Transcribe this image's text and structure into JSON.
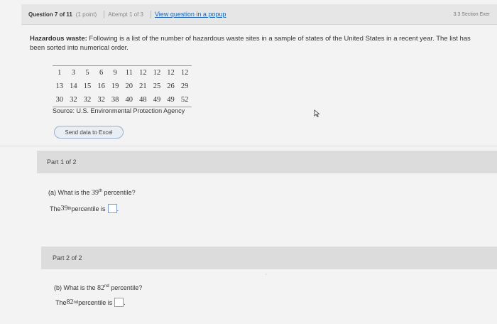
{
  "header": {
    "question_label": "Question 7 of 11",
    "points": "(1 point)",
    "attempt": "Attempt 1 of 3",
    "popup_link": "View question in a popup",
    "section": "3.3 Section Exer"
  },
  "problem": {
    "title": "Hazardous waste:",
    "text": " Following is a list of the number of hazardous waste sites in a sample of states of the United States in a recent year. The list has been sorted into numerical order."
  },
  "data_table": {
    "rows": [
      [
        "1",
        "3",
        "5",
        "6",
        "9",
        "11",
        "12",
        "12",
        "12",
        "12"
      ],
      [
        "13",
        "14",
        "15",
        "16",
        "19",
        "20",
        "21",
        "25",
        "26",
        "29"
      ],
      [
        "30",
        "32",
        "32",
        "32",
        "38",
        "40",
        "48",
        "49",
        "49",
        "52"
      ]
    ],
    "source": "Source: U.S. Environmental Protection Agency"
  },
  "actions": {
    "excel_button": "Send data to Excel"
  },
  "part1": {
    "header": "Part 1 of 2",
    "question_prefix": "(a) What is the ",
    "ordinal_num": "39",
    "ordinal_suffix": "th",
    "question_suffix": " percentile?",
    "answer_prefix": "The ",
    "answer_suffix": " percentile is",
    "answer_value": "",
    "period": "."
  },
  "part2": {
    "header": "Part 2 of 2",
    "question_prefix": "(b) What is the ",
    "ordinal_num": "82",
    "ordinal_suffix": "nd",
    "question_suffix": " percentile?",
    "answer_prefix": "The ",
    "answer_suffix": " percentile is",
    "answer_value": "",
    "period": "."
  },
  "icons": {
    "cursor": "mouse-cursor-icon"
  }
}
